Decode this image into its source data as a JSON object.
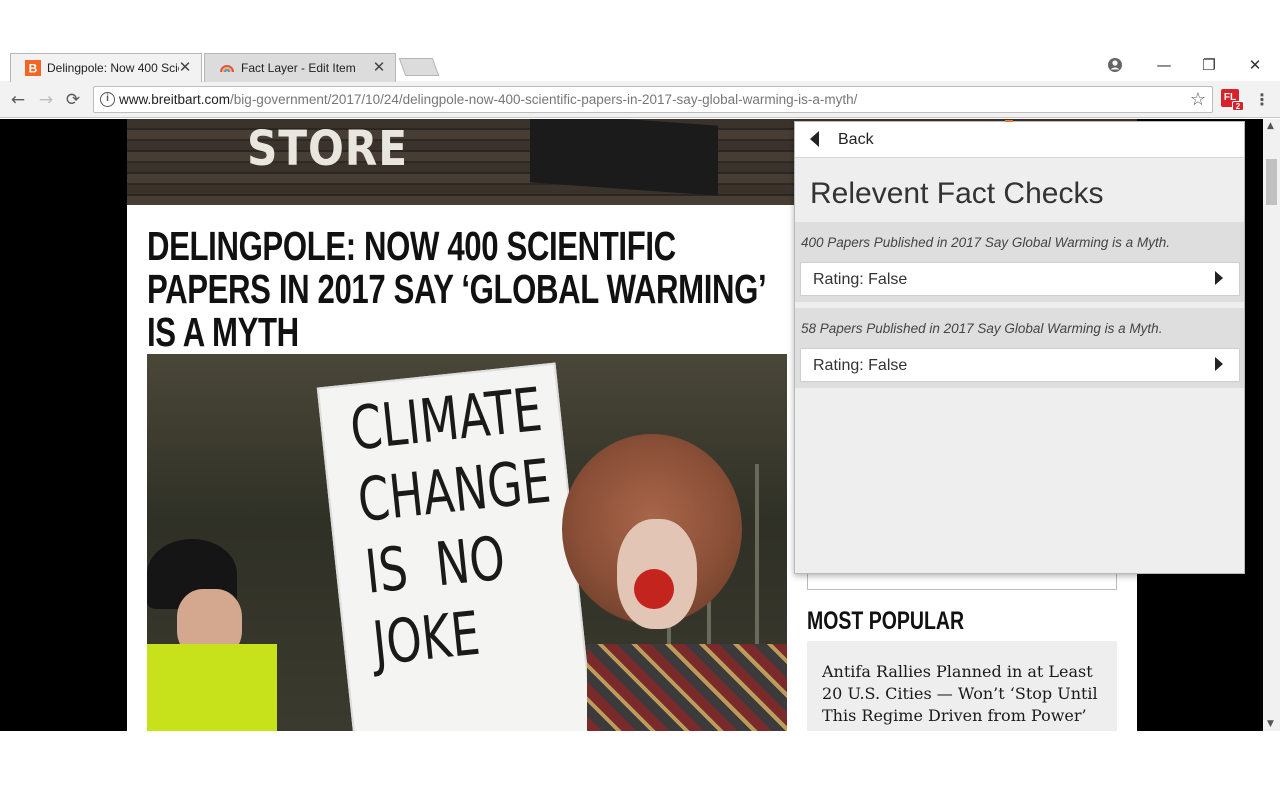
{
  "browser": {
    "tabs": [
      {
        "title": "Delingpole: Now 400 Scie",
        "close": "✕",
        "active": true,
        "favicon": "breitbart-b-icon"
      },
      {
        "title": "Fact Layer - Edit Item",
        "close": "✕",
        "active": false,
        "favicon": "fact-layer-icon"
      }
    ],
    "window_controls": {
      "minimize": "—",
      "maximize": "❐",
      "close": "✕"
    },
    "nav": {
      "back": "←",
      "forward": "→",
      "reload": "⟳"
    },
    "address": {
      "info_glyph": "i",
      "host": "www.breitbart.com",
      "path": "/big-government/2017/10/24/delingpole-now-400-scientific-papers-in-2017-say-global-warming-is-a-myth/",
      "star": "☆"
    },
    "extension": {
      "icon_label": "FL",
      "badge": "2"
    },
    "menu": "⋮"
  },
  "page": {
    "banner_text": "STORE",
    "headline": "Delingpole: Now 400 Scientific Papers in 2017 Say ‘Global Warming’ is a Myth",
    "photo_sign_text": "CLIMATE\nCHANGE\nIS  NO\nJOKE",
    "most_popular": {
      "heading": "Most Popular",
      "first_item": "Antifa Rallies Planned in at Least 20 U.S. Cities — Won’t ‘Stop Until This Regime Driven from Power’"
    }
  },
  "popup": {
    "back_label": "Back",
    "title": "Relevent Fact Checks",
    "items": [
      {
        "claim": "400 Papers Published in 2017 Say Global Warming is a Myth.",
        "rating": "Rating: False"
      },
      {
        "claim": "58 Papers Published in 2017 Say Global Warming is a Myth.",
        "rating": "Rating: False"
      }
    ]
  },
  "colors": {
    "breitbart_orange": "#f26522",
    "extension_red": "#d8222a",
    "popup_bg": "#eeeeee"
  }
}
